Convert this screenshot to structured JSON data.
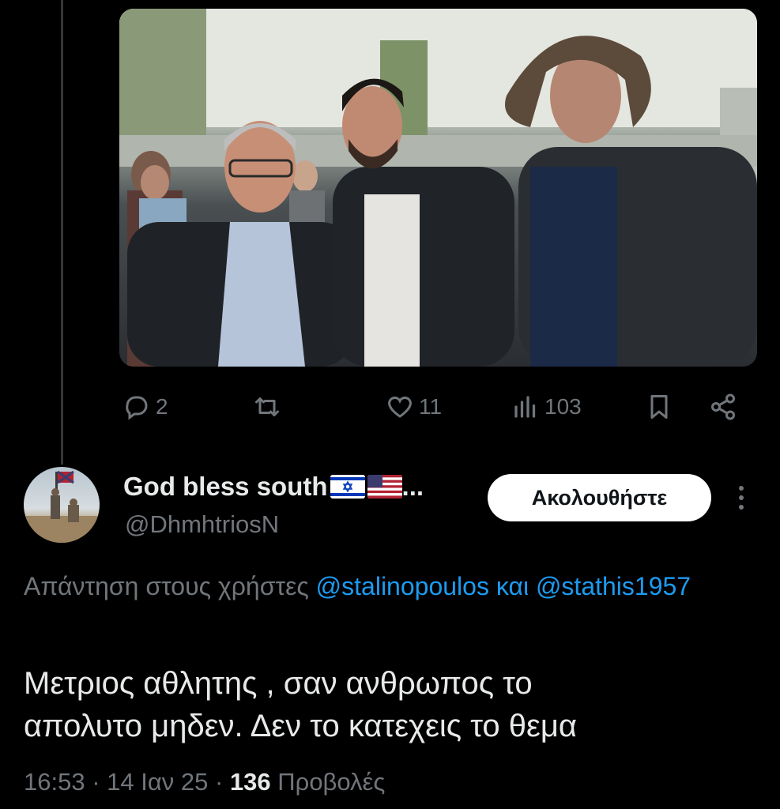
{
  "tweet_actions": {
    "replies": "2",
    "likes": "11",
    "views": "103"
  },
  "reply": {
    "display_name": "God bless south",
    "display_name_suffix": "...",
    "handle": "@DhmhtriosN",
    "follow_label": "Ακολουθήστε",
    "reply_prefix": "Απάντηση στους χρήστες",
    "mention_1": "@stalinopoulos",
    "mention_joiner": "και",
    "mention_2": "@stathis1957",
    "text_line_1": "Μετριος αθλητης , σαν ανθρωπος το",
    "text_line_2": "απολυτο μηδεν. Δεν το κατεχεις το θεμα",
    "time": "16:53",
    "date": "14 Ιαν 25",
    "views_count": "136",
    "views_label": "Προβολές"
  },
  "icons": {
    "reply": "reply-icon",
    "retweet": "retweet-icon",
    "like": "heart-icon",
    "views": "views-icon",
    "bookmark": "bookmark-icon",
    "share": "share-icon",
    "more": "more-icon"
  },
  "colors": {
    "background": "#000000",
    "text": "#e7e9ea",
    "muted": "#71767b",
    "link": "#1d9bf0",
    "follow_bg": "#ffffff"
  }
}
